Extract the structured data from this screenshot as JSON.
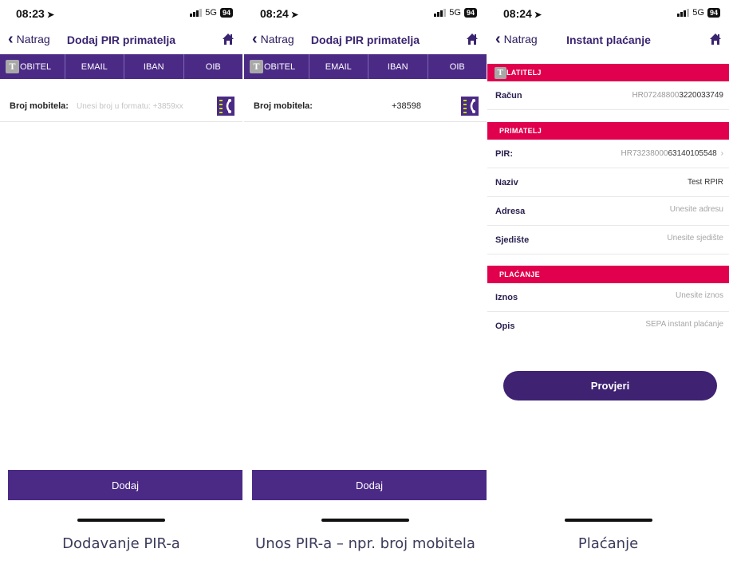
{
  "screens": [
    {
      "status": {
        "time": "08:23",
        "network": "5G",
        "battery": "94"
      },
      "nav": {
        "back": "Natrag",
        "title": "Dodaj PIR primatelja"
      },
      "tabs": [
        "OBITEL",
        "EMAIL",
        "IBAN",
        "OIB"
      ],
      "tab_marker": "T",
      "field": {
        "label": "Broj mobitela:",
        "value": "",
        "placeholder": "Unesi broj u formatu: +3859xx"
      },
      "button": "Dodaj",
      "caption": "Dodavanje PIR-a"
    },
    {
      "status": {
        "time": "08:24",
        "network": "5G",
        "battery": "94"
      },
      "nav": {
        "back": "Natrag",
        "title": "Dodaj PIR primatelja"
      },
      "tabs": [
        "OBITEL",
        "EMAIL",
        "IBAN",
        "OIB"
      ],
      "tab_marker": "T",
      "field": {
        "label": "Broj mobitela:",
        "value": "+38598",
        "placeholder": ""
      },
      "button": "Dodaj",
      "caption": "Unos PIR-a – npr. broj mobitela"
    },
    {
      "status": {
        "time": "08:24",
        "network": "5G",
        "battery": "94"
      },
      "nav": {
        "back": "Natrag",
        "title": "Instant plaćanje"
      },
      "sections": {
        "payer": {
          "marker": "T",
          "title": "LATITELJ"
        },
        "payee": {
          "title": "PRIMATELJ"
        },
        "payment": {
          "title": "PLAĆANJE"
        }
      },
      "rows": {
        "account": {
          "label": "Račun",
          "value_prefix": "HR07248800",
          "value_suffix": "3220033749"
        },
        "pir": {
          "label": "PIR:",
          "value_prefix": "HR73238000",
          "value_suffix": "63140105548"
        },
        "name": {
          "label": "Naziv",
          "value": "Test RPIR"
        },
        "address": {
          "label": "Adresa",
          "placeholder": "Unesite adresu"
        },
        "seat": {
          "label": "Sjedište",
          "placeholder": "Unesite sjedište"
        },
        "amount": {
          "label": "Iznos",
          "placeholder": "Unesite iznos"
        },
        "description": {
          "label": "Opis",
          "placeholder": "SEPA instant plaćanje"
        }
      },
      "button": "Provjeri",
      "caption": "Plaćanje"
    }
  ],
  "colors": {
    "accent": "#4b2a86",
    "section": "#e0004d",
    "text_dark": "#2b2150"
  },
  "icons": {
    "back": "chevron-left-icon",
    "home": "home-icon",
    "contact": "contact-book-icon",
    "location": "location-arrow-icon"
  }
}
